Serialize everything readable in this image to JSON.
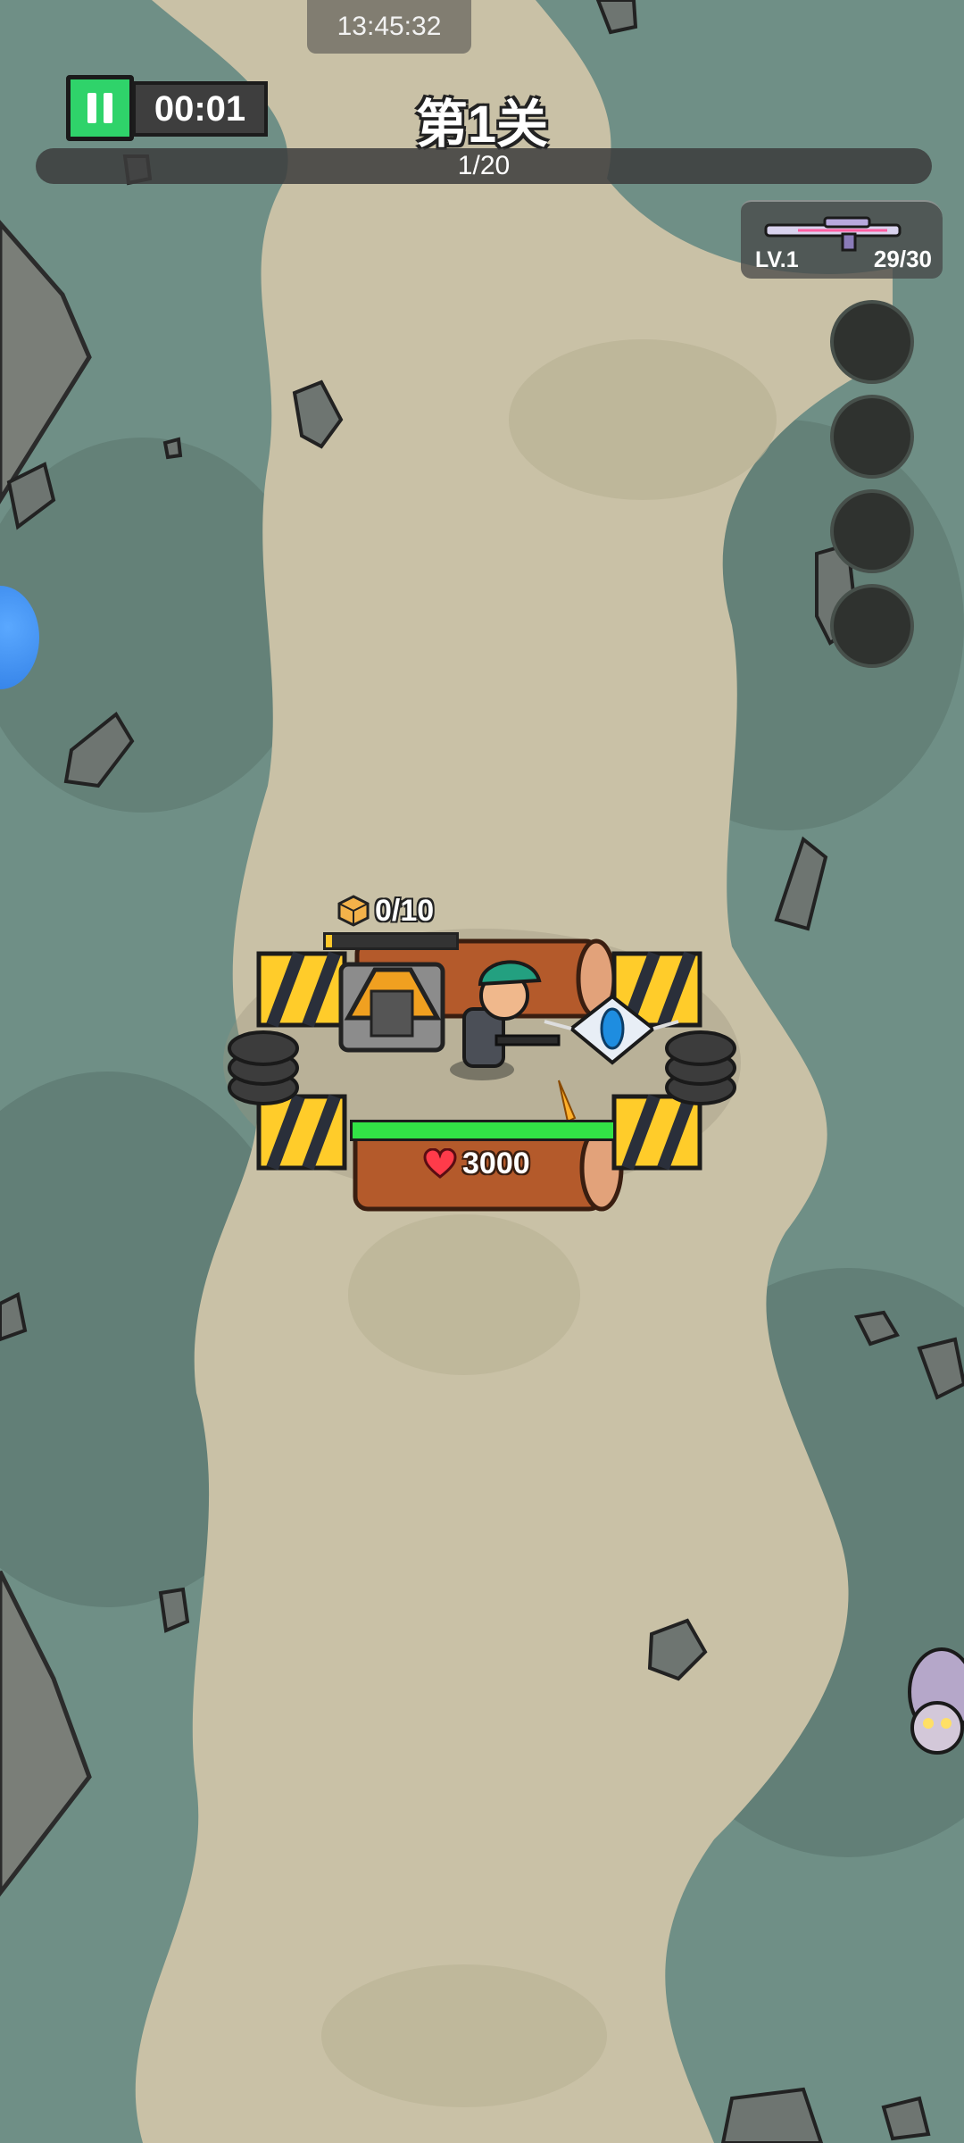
{
  "status_bar": {
    "time": "13:45:32"
  },
  "hud": {
    "timer": "00:01",
    "level_title": "第1关",
    "wave_progress": "1/20",
    "wave_fraction": 0.05
  },
  "weapon": {
    "level": "LV.1",
    "ammo": "29/30",
    "icon": "rifle-icon"
  },
  "skills": [
    {
      "name": "skill-slot-1"
    },
    {
      "name": "skill-slot-2"
    },
    {
      "name": "skill-slot-3"
    },
    {
      "name": "skill-slot-4"
    }
  ],
  "base": {
    "resource": "0/10",
    "resource_fraction": 0.05,
    "hp": "3000",
    "hp_fraction": 1.0
  },
  "colors": {
    "grass": "#6f8f86",
    "path": "#c9c1a6",
    "pause_green": "#2fd36a",
    "hp_green": "#32e246",
    "resource_yellow": "#ffc82a"
  }
}
